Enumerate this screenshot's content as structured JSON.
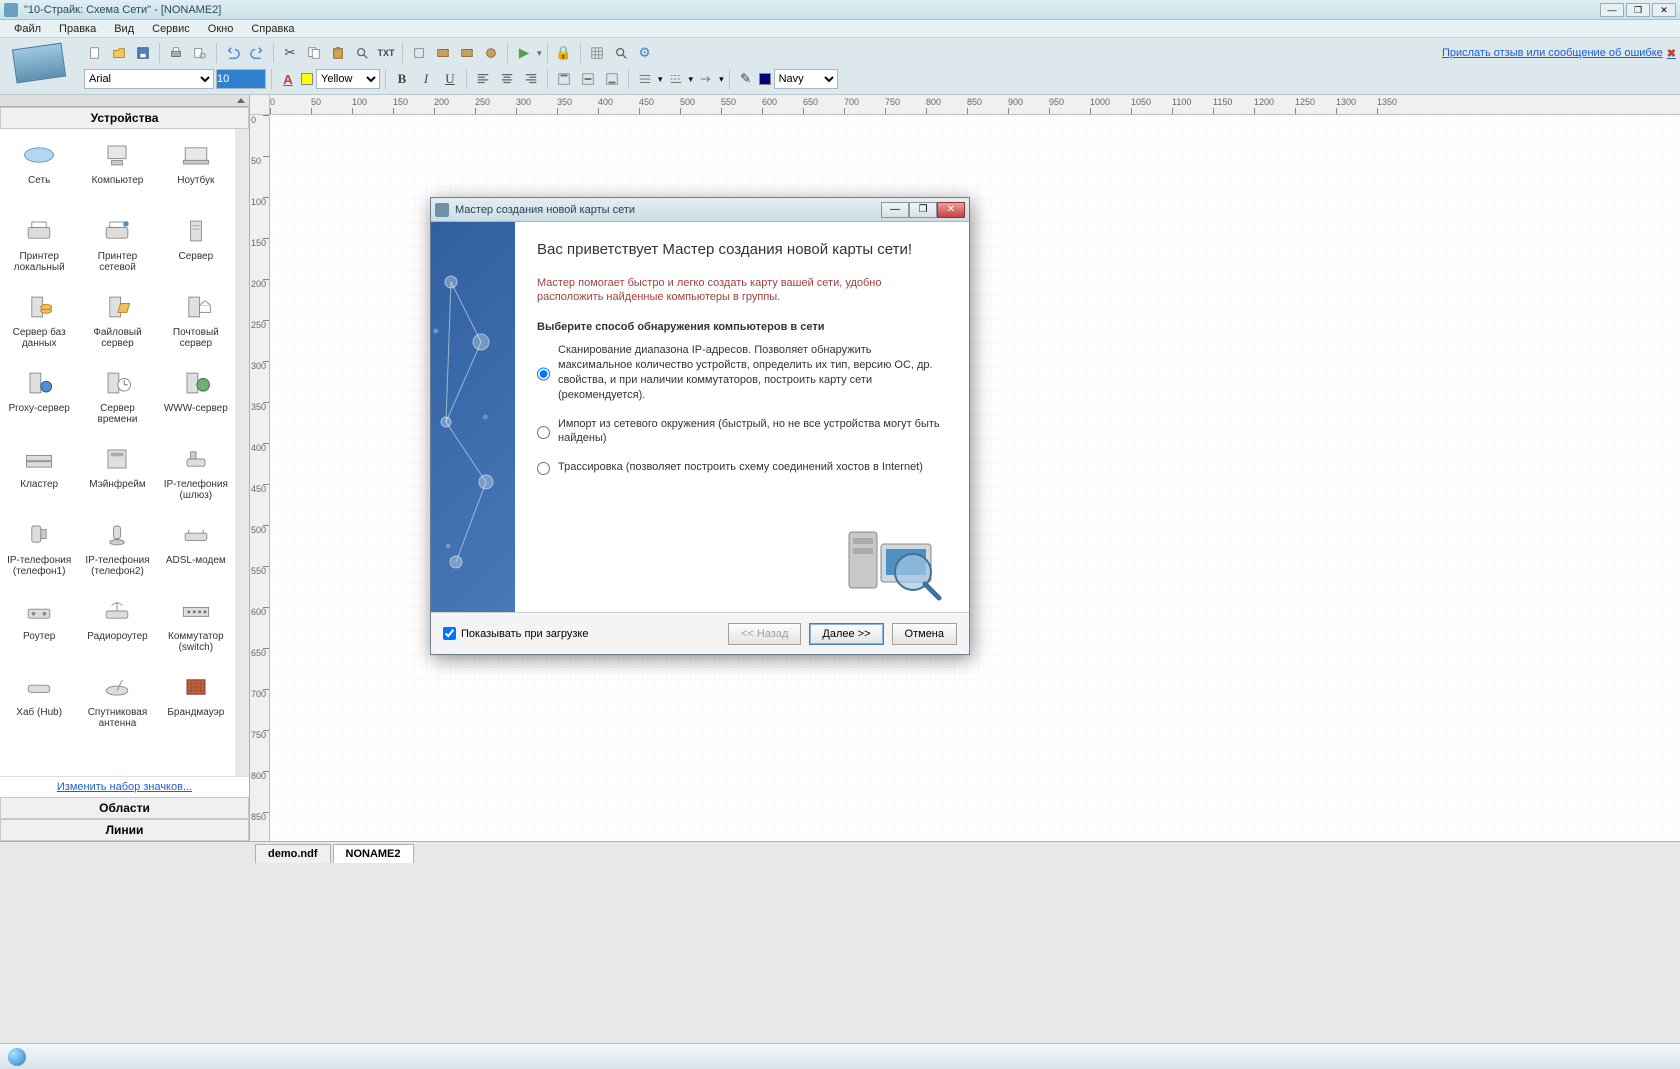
{
  "window": {
    "title": "\"10-Страйк: Схема Сети\" - [NONAME2]"
  },
  "menu": {
    "items": [
      "Файл",
      "Правка",
      "Вид",
      "Сервис",
      "Окно",
      "Справка"
    ]
  },
  "toolbar": {
    "feedback_link": "Прислать отзыв или сообщение об ошибке",
    "font_family": "Arial",
    "font_size": "10",
    "fill_color_label": "Yellow",
    "line_color_label": "Navy"
  },
  "sidebar": {
    "header_devices": "Устройства",
    "header_areas": "Области",
    "header_lines": "Линии",
    "change_icons": "Изменить набор значков...",
    "devices": [
      "Сеть",
      "Компьютер",
      "Ноутбук",
      "Принтер локальный",
      "Принтер сетевой",
      "Сервер",
      "Сервер баз данных",
      "Файловый сервер",
      "Почтовый сервер",
      "Proxy-сервер",
      "Сервер времени",
      "WWW-сервер",
      "Кластер",
      "Мэйнфрейм",
      "IP-телефония (шлюз)",
      "IP-телефония (телефон1)",
      "IP-телефония (телефон2)",
      "ADSL-модем",
      "Роутер",
      "Радиороутер",
      "Коммутатор (switch)",
      "Хаб (Hub)",
      "Спутниковая антенна",
      "Брандмауэр"
    ]
  },
  "tabs": {
    "items": [
      "demo.ndf",
      "NONAME2"
    ],
    "active": 1
  },
  "wizard": {
    "title": "Мастер создания новой карты сети",
    "heading": "Вас приветствует Мастер создания новой карты сети!",
    "desc": "Мастер помогает быстро и легко создать карту вашей сети, удобно расположить найденные компьютеры в группы.",
    "section": "Выберите способ обнаружения компьютеров в сети",
    "opt1": "Сканирование диапазона IP-адресов. Позволяет обнаружить максимальное количество устройств, определить их тип, версию ОС, др. свойства, и при наличии коммутаторов, построить карту сети (рекомендуется).",
    "opt2": "Импорт из сетевого окружения (быстрый, но не все устройства могут быть найдены)",
    "opt3": "Трассировка (позволяет построить схему соединений хостов в Internet)",
    "show_on_load": "Показывать при загрузке",
    "btn_back": "<< Назад",
    "btn_next": "Далее >>",
    "btn_cancel": "Отмена"
  },
  "ruler_marks": [
    0,
    50,
    100,
    150,
    200,
    250,
    300,
    350,
    400,
    450,
    500,
    550,
    600,
    650,
    700,
    750,
    800,
    850,
    900,
    950,
    1000,
    1050,
    1100,
    1150,
    1200,
    1250,
    1300,
    1350
  ]
}
